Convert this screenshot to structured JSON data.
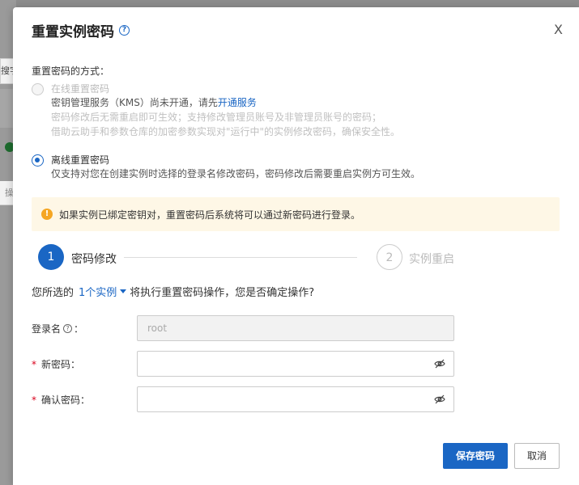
{
  "background": {
    "chip_text": "搜字",
    "chip3_text": "操"
  },
  "dialog": {
    "title": "重置实例密码",
    "close_label": "X",
    "method_label": "重置密码的方式：",
    "options": [
      {
        "title": "在线重置密码",
        "line1_prefix": "密钥管理服务（KMS）尚未开通，请先",
        "line1_link": "开通服务",
        "line2": "密码修改后无需重启即可生效；支持修改管理员账号及非管理员账号的密码；",
        "line3": "借助云助手和参数仓库的加密参数实现对\"运行中\"的实例修改密码，确保安全性。"
      },
      {
        "title": "离线重置密码",
        "line1": "仅支持对您在创建实例时选择的登录名修改密码，密码修改后需要重启实例方可生效。"
      }
    ],
    "alert": "如果实例已绑定密钥对，重置密码后系统将可以通过新密码进行登录。",
    "steps": [
      {
        "num": "1",
        "label": "密码修改"
      },
      {
        "num": "2",
        "label": "实例重启"
      }
    ],
    "confirm": {
      "prefix": "您所选的",
      "link": "1个实例",
      "suffix": "将执行重置密码操作，您是否确定操作?"
    },
    "form": {
      "login_label": "登录名",
      "login_suffix": "：",
      "login_value": "root",
      "new_pw_label": "新密码：",
      "confirm_pw_label": "确认密码："
    },
    "buttons": {
      "save": "保存密码",
      "cancel": "取消"
    }
  }
}
